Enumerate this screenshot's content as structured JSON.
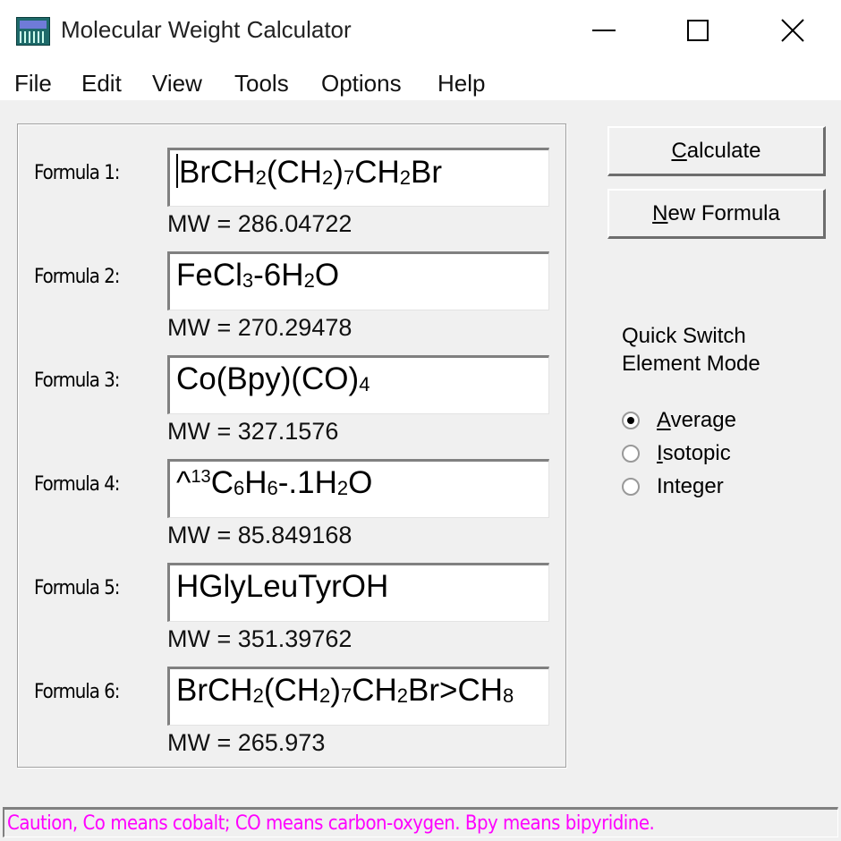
{
  "window": {
    "title": "Molecular Weight Calculator",
    "icon": "calculator-icon",
    "controls": [
      "minimize-icon",
      "maximize-icon",
      "close-icon"
    ]
  },
  "menu": [
    "File",
    "Edit",
    "View",
    "Tools",
    "Options",
    "Help"
  ],
  "formulas": [
    {
      "label": "Formula 1:",
      "value": "BrCH2(CH2)7CH2Br",
      "mw": "MW = 286.04722"
    },
    {
      "label": "Formula 2:",
      "value": "FeCl3-6H2O",
      "mw": "MW = 270.29478"
    },
    {
      "label": "Formula 3:",
      "value": "Co(Bpy)(CO)4",
      "mw": "MW = 327.1576"
    },
    {
      "label": "Formula 4:",
      "value": "^13C6H6-.1H2O",
      "mw": "MW = 85.849168"
    },
    {
      "label": "Formula 5:",
      "value": "HGlyLeuTyrOH",
      "mw": "MW = 351.39762"
    },
    {
      "label": "Formula 6:",
      "value": "BrCH2(CH2)7CH2Br>CH8",
      "mw": "MW = 265.973"
    }
  ],
  "buttons": {
    "calculate": {
      "label": "Calculate",
      "accel": "C",
      "rest": "alculate"
    },
    "new_formula": {
      "label": "New Formula",
      "accel": "N",
      "rest": "ew Formula"
    }
  },
  "element_mode": {
    "heading_line1": "Quick Switch",
    "heading_line2": "Element Mode",
    "options": [
      {
        "label": "Average",
        "accel": "A",
        "rest": "verage",
        "selected": true
      },
      {
        "label": "Isotopic",
        "accel": "I",
        "rest": "sotopic",
        "selected": false
      },
      {
        "label": "Integer",
        "accel": "",
        "rest": "Integer",
        "selected": false
      }
    ]
  },
  "status": {
    "text": "Caution, Co means cobalt; CO means carbon-oxygen.  Bpy means bipyridine.",
    "color": "#ff00ff"
  }
}
